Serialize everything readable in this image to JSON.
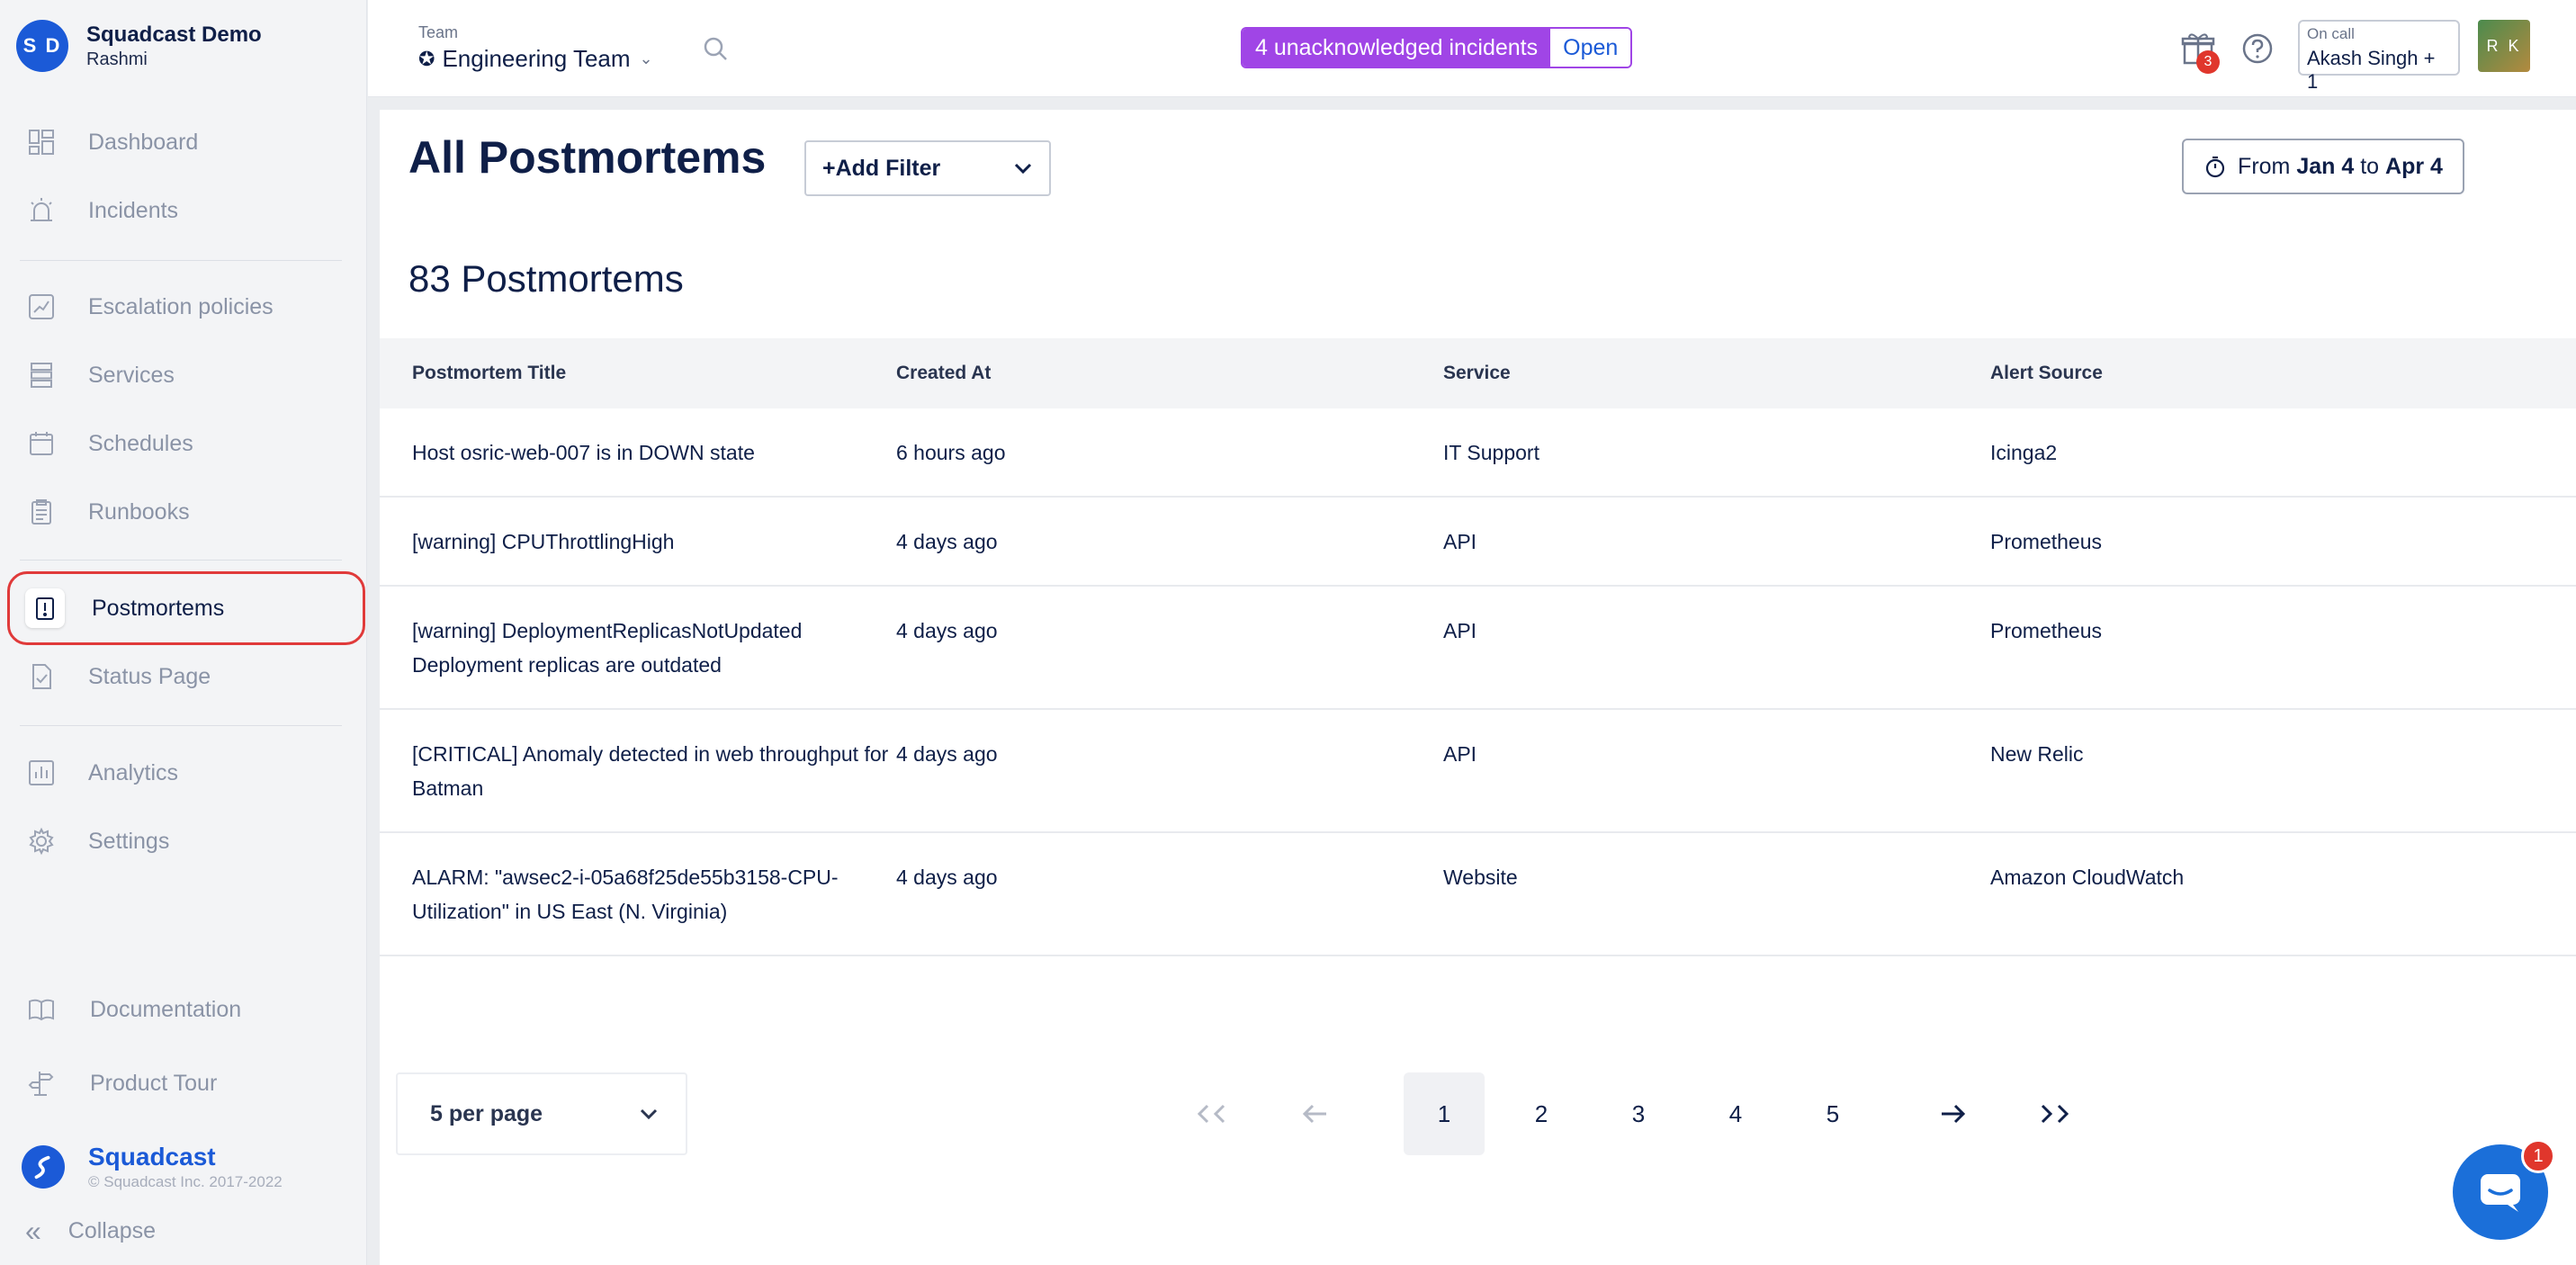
{
  "org": {
    "initials": "S D",
    "name": "Squadcast Demo",
    "user": "Rashmi"
  },
  "nav": [
    {
      "label": "Dashboard",
      "icon": "dashboard-icon"
    },
    {
      "label": "Incidents",
      "icon": "siren-icon"
    },
    {
      "label": "Escalation policies",
      "icon": "escalation-icon"
    },
    {
      "label": "Services",
      "icon": "services-icon"
    },
    {
      "label": "Schedules",
      "icon": "calendar-icon"
    },
    {
      "label": "Runbooks",
      "icon": "clipboard-icon"
    },
    {
      "label": "Postmortems",
      "icon": "postmortem-icon",
      "active": true
    },
    {
      "label": "Status Page",
      "icon": "status-page-icon"
    },
    {
      "label": "Analytics",
      "icon": "analytics-icon"
    },
    {
      "label": "Settings",
      "icon": "gear-icon"
    },
    {
      "label": "Documentation",
      "icon": "book-icon"
    },
    {
      "label": "Product Tour",
      "icon": "signpost-icon"
    }
  ],
  "brand": {
    "name": "Squadcast",
    "copyright": "© Squadcast Inc. 2017-2022"
  },
  "collapse_label": "Collapse",
  "topbar": {
    "team_label": "Team",
    "team_name": "Engineering Team",
    "incidents_text": "4 unacknowledged incidents",
    "incidents_open": "Open",
    "gift_badge": "3",
    "oncall_label": "On call",
    "oncall_name": "Akash Singh + 1",
    "user_initials": "R K"
  },
  "page": {
    "title": "All Postmortems",
    "add_filter": "+Add Filter",
    "date_from_prefix": "From",
    "date_from": "Jan 4",
    "date_to_prefix": "to",
    "date_to": "Apr 4",
    "count_title": "83 Postmortems"
  },
  "table": {
    "headers": [
      "Postmortem Title",
      "Created At",
      "Service",
      "Alert Source"
    ],
    "rows": [
      {
        "title": "Host osric-web-007 is in DOWN state",
        "created": "6 hours ago",
        "service": "IT Support",
        "source": "Icinga2"
      },
      {
        "title": "[warning] CPUThrottlingHigh",
        "created": "4 days ago",
        "service": "API",
        "source": "Prometheus"
      },
      {
        "title": "[warning] DeploymentReplicasNotUpdated Deployment replicas are outdated",
        "created": "4 days ago",
        "service": "API",
        "source": "Prometheus"
      },
      {
        "title": "[CRITICAL] Anomaly detected in web throughput for Batman",
        "created": "4 days ago",
        "service": "API",
        "source": "New Relic"
      },
      {
        "title": "ALARM: \"awsec2-i-05a68f25de55b3158-CPU-Utilization\" in US East (N. Virginia)",
        "created": "4 days ago",
        "service": "Website",
        "source": "Amazon CloudWatch"
      }
    ]
  },
  "pagination": {
    "per_page": "5 per page",
    "pages": [
      "1",
      "2",
      "3",
      "4",
      "5"
    ],
    "current": "1"
  },
  "chat_badge": "1",
  "colors": {
    "accent": "#1b5ad7",
    "incident": "#a045e6",
    "highlight": "#e03a3a"
  }
}
